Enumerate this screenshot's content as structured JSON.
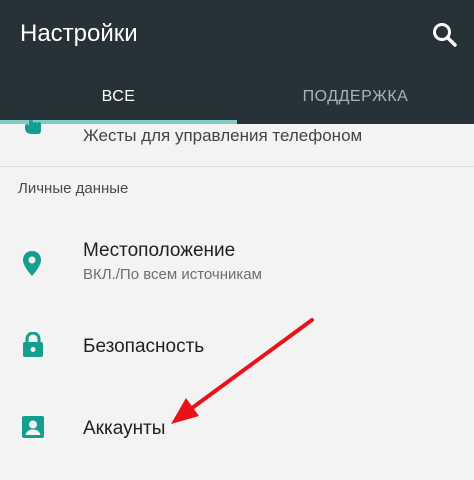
{
  "app": {
    "title": "Настройки"
  },
  "tabs": [
    {
      "label": "ВСЕ",
      "selected": true
    },
    {
      "label": "ПОДДЕРЖКА",
      "selected": false
    }
  ],
  "items": {
    "gestures": {
      "title": "Жесты для управления телефоном"
    },
    "section_header": "Личные данные",
    "location": {
      "title": "Местоположение",
      "subtitle": "ВКЛ./По всем источникам"
    },
    "security": {
      "title": "Безопасность"
    },
    "accounts": {
      "title": "Аккаунты"
    }
  },
  "colors": {
    "app_bar": "#263238",
    "tab_indicator": "#80cbc4",
    "icon_accent": "#139e8e",
    "annotation_arrow": "#e8131a"
  },
  "icons": {
    "search": "search-icon",
    "gesture": "gesture-hand-icon",
    "location": "location-pin-icon",
    "security": "lock-icon",
    "accounts": "account-box-icon"
  }
}
